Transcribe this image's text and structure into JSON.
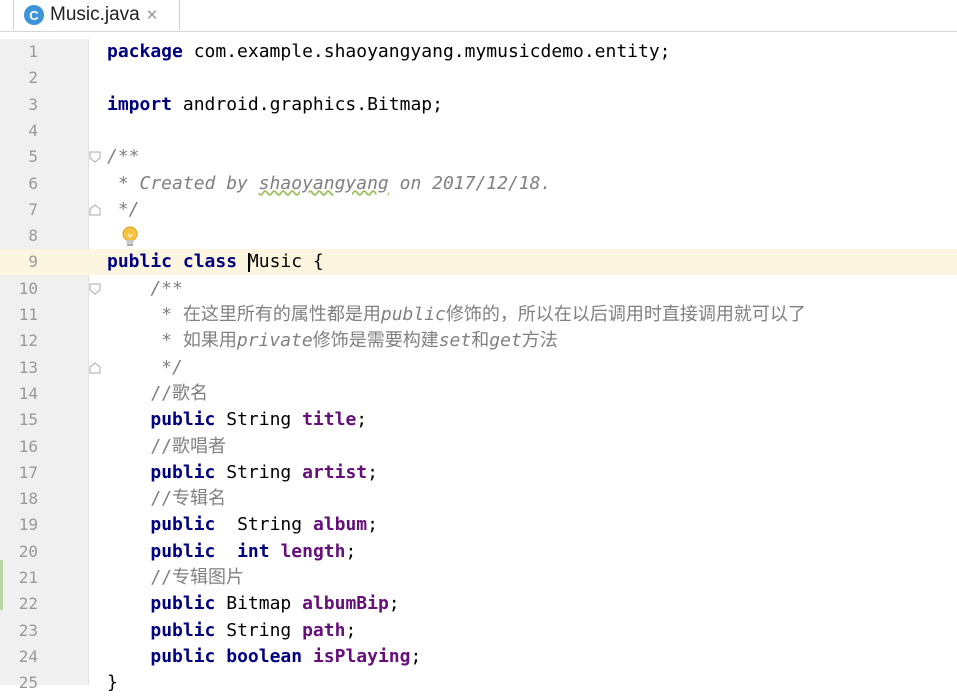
{
  "tab": {
    "icon_letter": "C",
    "label": "Music.java",
    "close_glyph": "✕"
  },
  "editor": {
    "current_line": 9,
    "lines": [
      {
        "n": "1",
        "segs": [
          {
            "t": "package",
            "c": "kw"
          },
          {
            "t": " com.example.shaoyangyang.mymusicdemo.entity;",
            "c": ""
          }
        ]
      },
      {
        "n": "2",
        "segs": []
      },
      {
        "n": "3",
        "segs": [
          {
            "t": "import",
            "c": "kw"
          },
          {
            "t": " android.graphics.Bitmap;",
            "c": ""
          }
        ]
      },
      {
        "n": "4",
        "segs": []
      },
      {
        "n": "5",
        "segs": [
          {
            "t": "/**",
            "c": "cmt"
          }
        ]
      },
      {
        "n": "6",
        "segs": [
          {
            "t": " * Created by ",
            "c": "cmt"
          },
          {
            "t": "shaoyangyang",
            "c": "cmt squig"
          },
          {
            "t": " on 2017/12/18.",
            "c": "cmt"
          }
        ]
      },
      {
        "n": "7",
        "segs": [
          {
            "t": " */",
            "c": "cmt"
          }
        ]
      },
      {
        "n": "8",
        "segs": []
      },
      {
        "n": "9",
        "segs": [
          {
            "t": "public",
            "c": "kw"
          },
          {
            "t": " ",
            "c": ""
          },
          {
            "t": "class",
            "c": "kw"
          },
          {
            "t": " ",
            "c": ""
          },
          {
            "t": "",
            "c": "caret"
          },
          {
            "t": "Music {",
            "c": ""
          }
        ]
      },
      {
        "n": "10",
        "segs": [
          {
            "t": "    /**",
            "c": "cmt"
          }
        ]
      },
      {
        "n": "11",
        "segs": [
          {
            "t": "     * ",
            "c": "cmt"
          },
          {
            "t": "在这里所有的属性都是用",
            "c": "cmt cjk"
          },
          {
            "t": "public",
            "c": "cmt"
          },
          {
            "t": "修饰的，所以在以后调用时直接调用就可以了",
            "c": "cmt cjk"
          }
        ]
      },
      {
        "n": "12",
        "segs": [
          {
            "t": "     * ",
            "c": "cmt"
          },
          {
            "t": "如果用",
            "c": "cmt cjk"
          },
          {
            "t": "private",
            "c": "cmt"
          },
          {
            "t": "修饰是需要构建",
            "c": "cmt cjk"
          },
          {
            "t": "set",
            "c": "cmt"
          },
          {
            "t": "和",
            "c": "cmt cjk"
          },
          {
            "t": "get",
            "c": "cmt"
          },
          {
            "t": "方法",
            "c": "cmt cjk"
          }
        ]
      },
      {
        "n": "13",
        "segs": [
          {
            "t": "     */",
            "c": "cmt"
          }
        ]
      },
      {
        "n": "14",
        "segs": [
          {
            "t": "    //",
            "c": "cmtl"
          },
          {
            "t": "歌名",
            "c": "cmtl cjk"
          }
        ]
      },
      {
        "n": "15",
        "segs": [
          {
            "t": "    ",
            "c": ""
          },
          {
            "t": "public",
            "c": "kw"
          },
          {
            "t": " String ",
            "c": ""
          },
          {
            "t": "title",
            "c": "fld"
          },
          {
            "t": ";",
            "c": ""
          }
        ]
      },
      {
        "n": "16",
        "segs": [
          {
            "t": "    //",
            "c": "cmtl"
          },
          {
            "t": "歌唱者",
            "c": "cmtl cjk"
          }
        ]
      },
      {
        "n": "17",
        "segs": [
          {
            "t": "    ",
            "c": ""
          },
          {
            "t": "public",
            "c": "kw"
          },
          {
            "t": " String ",
            "c": ""
          },
          {
            "t": "artist",
            "c": "fld"
          },
          {
            "t": ";",
            "c": ""
          }
        ]
      },
      {
        "n": "18",
        "segs": [
          {
            "t": "    //",
            "c": "cmtl"
          },
          {
            "t": "专辑名",
            "c": "cmtl cjk"
          }
        ]
      },
      {
        "n": "19",
        "segs": [
          {
            "t": "    ",
            "c": ""
          },
          {
            "t": "public",
            "c": "kw"
          },
          {
            "t": "  String ",
            "c": ""
          },
          {
            "t": "album",
            "c": "fld"
          },
          {
            "t": ";",
            "c": ""
          }
        ]
      },
      {
        "n": "20",
        "segs": [
          {
            "t": "    ",
            "c": ""
          },
          {
            "t": "public",
            "c": "kw"
          },
          {
            "t": "  ",
            "c": ""
          },
          {
            "t": "int",
            "c": "kw"
          },
          {
            "t": " ",
            "c": ""
          },
          {
            "t": "length",
            "c": "fld"
          },
          {
            "t": ";",
            "c": ""
          }
        ]
      },
      {
        "n": "21",
        "segs": [
          {
            "t": "    //",
            "c": "cmtl"
          },
          {
            "t": "专辑图片",
            "c": "cmtl cjk"
          }
        ]
      },
      {
        "n": "22",
        "segs": [
          {
            "t": "    ",
            "c": ""
          },
          {
            "t": "public",
            "c": "kw"
          },
          {
            "t": " Bitmap ",
            "c": ""
          },
          {
            "t": "albumBip",
            "c": "fld"
          },
          {
            "t": ";",
            "c": ""
          }
        ]
      },
      {
        "n": "23",
        "segs": [
          {
            "t": "    ",
            "c": ""
          },
          {
            "t": "public",
            "c": "kw"
          },
          {
            "t": " String ",
            "c": ""
          },
          {
            "t": "path",
            "c": "fld"
          },
          {
            "t": ";",
            "c": ""
          }
        ]
      },
      {
        "n": "24",
        "segs": [
          {
            "t": "    ",
            "c": ""
          },
          {
            "t": "public",
            "c": "kw"
          },
          {
            "t": " ",
            "c": ""
          },
          {
            "t": "boolean",
            "c": "kw"
          },
          {
            "t": " ",
            "c": ""
          },
          {
            "t": "isPlaying",
            "c": "fld"
          },
          {
            "t": ";",
            "c": ""
          }
        ]
      },
      {
        "n": "25",
        "segs": [
          {
            "t": "}",
            "c": ""
          }
        ]
      }
    ]
  },
  "fold_markers": [
    {
      "line": 5,
      "kind": "open"
    },
    {
      "line": 7,
      "kind": "close"
    },
    {
      "line": 10,
      "kind": "open"
    },
    {
      "line": 13,
      "kind": "close"
    }
  ],
  "icons": {
    "bulb": "lightbulb-intention-icon",
    "class_icon": "java-class-icon"
  },
  "colors": {
    "keyword": "#000080",
    "field": "#660e7a",
    "comment": "#808080",
    "current_line": "#fcf6e0",
    "gutter": "#f0f0f0"
  }
}
